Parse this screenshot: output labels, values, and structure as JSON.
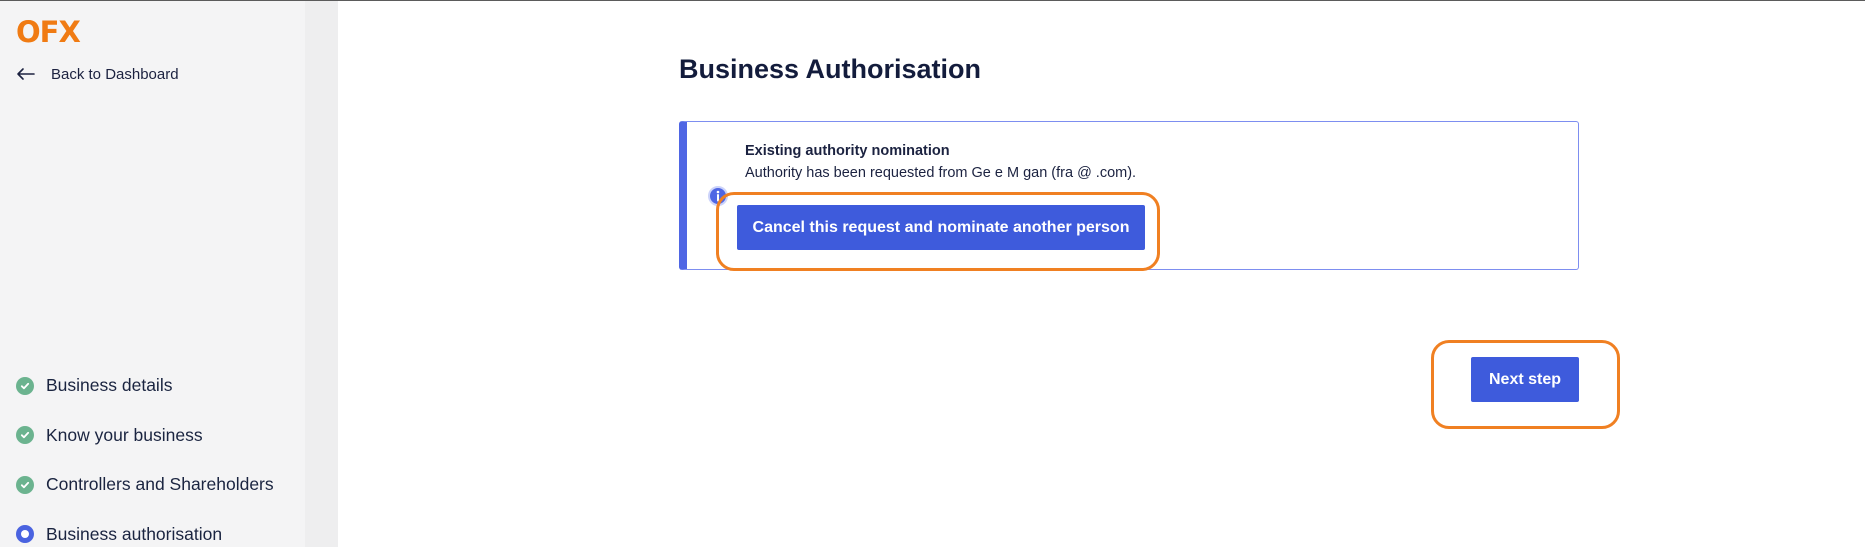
{
  "brand": {
    "logo_text": "OFX",
    "accent_color": "#f07b13"
  },
  "sidebar": {
    "back_label": "Back to Dashboard",
    "steps": [
      {
        "label": "Business details",
        "status": "complete"
      },
      {
        "label": "Know your business",
        "status": "complete"
      },
      {
        "label": "Controllers and Shareholders",
        "status": "complete"
      },
      {
        "label": "Business authorisation",
        "status": "current"
      }
    ]
  },
  "main": {
    "title": "Business Authorisation",
    "notice": {
      "icon": "info-icon",
      "title": "Existing authority nomination",
      "text": "Authority has been requested from Ge     e M     gan (fra                                    @     .com).",
      "button_label": "Cancel this request and nominate another person"
    },
    "next_label": "Next step"
  },
  "colors": {
    "primary": "#3e5bdc",
    "highlight": "#f08022",
    "complete": "#6bb38f",
    "current": "#4a63e0"
  }
}
